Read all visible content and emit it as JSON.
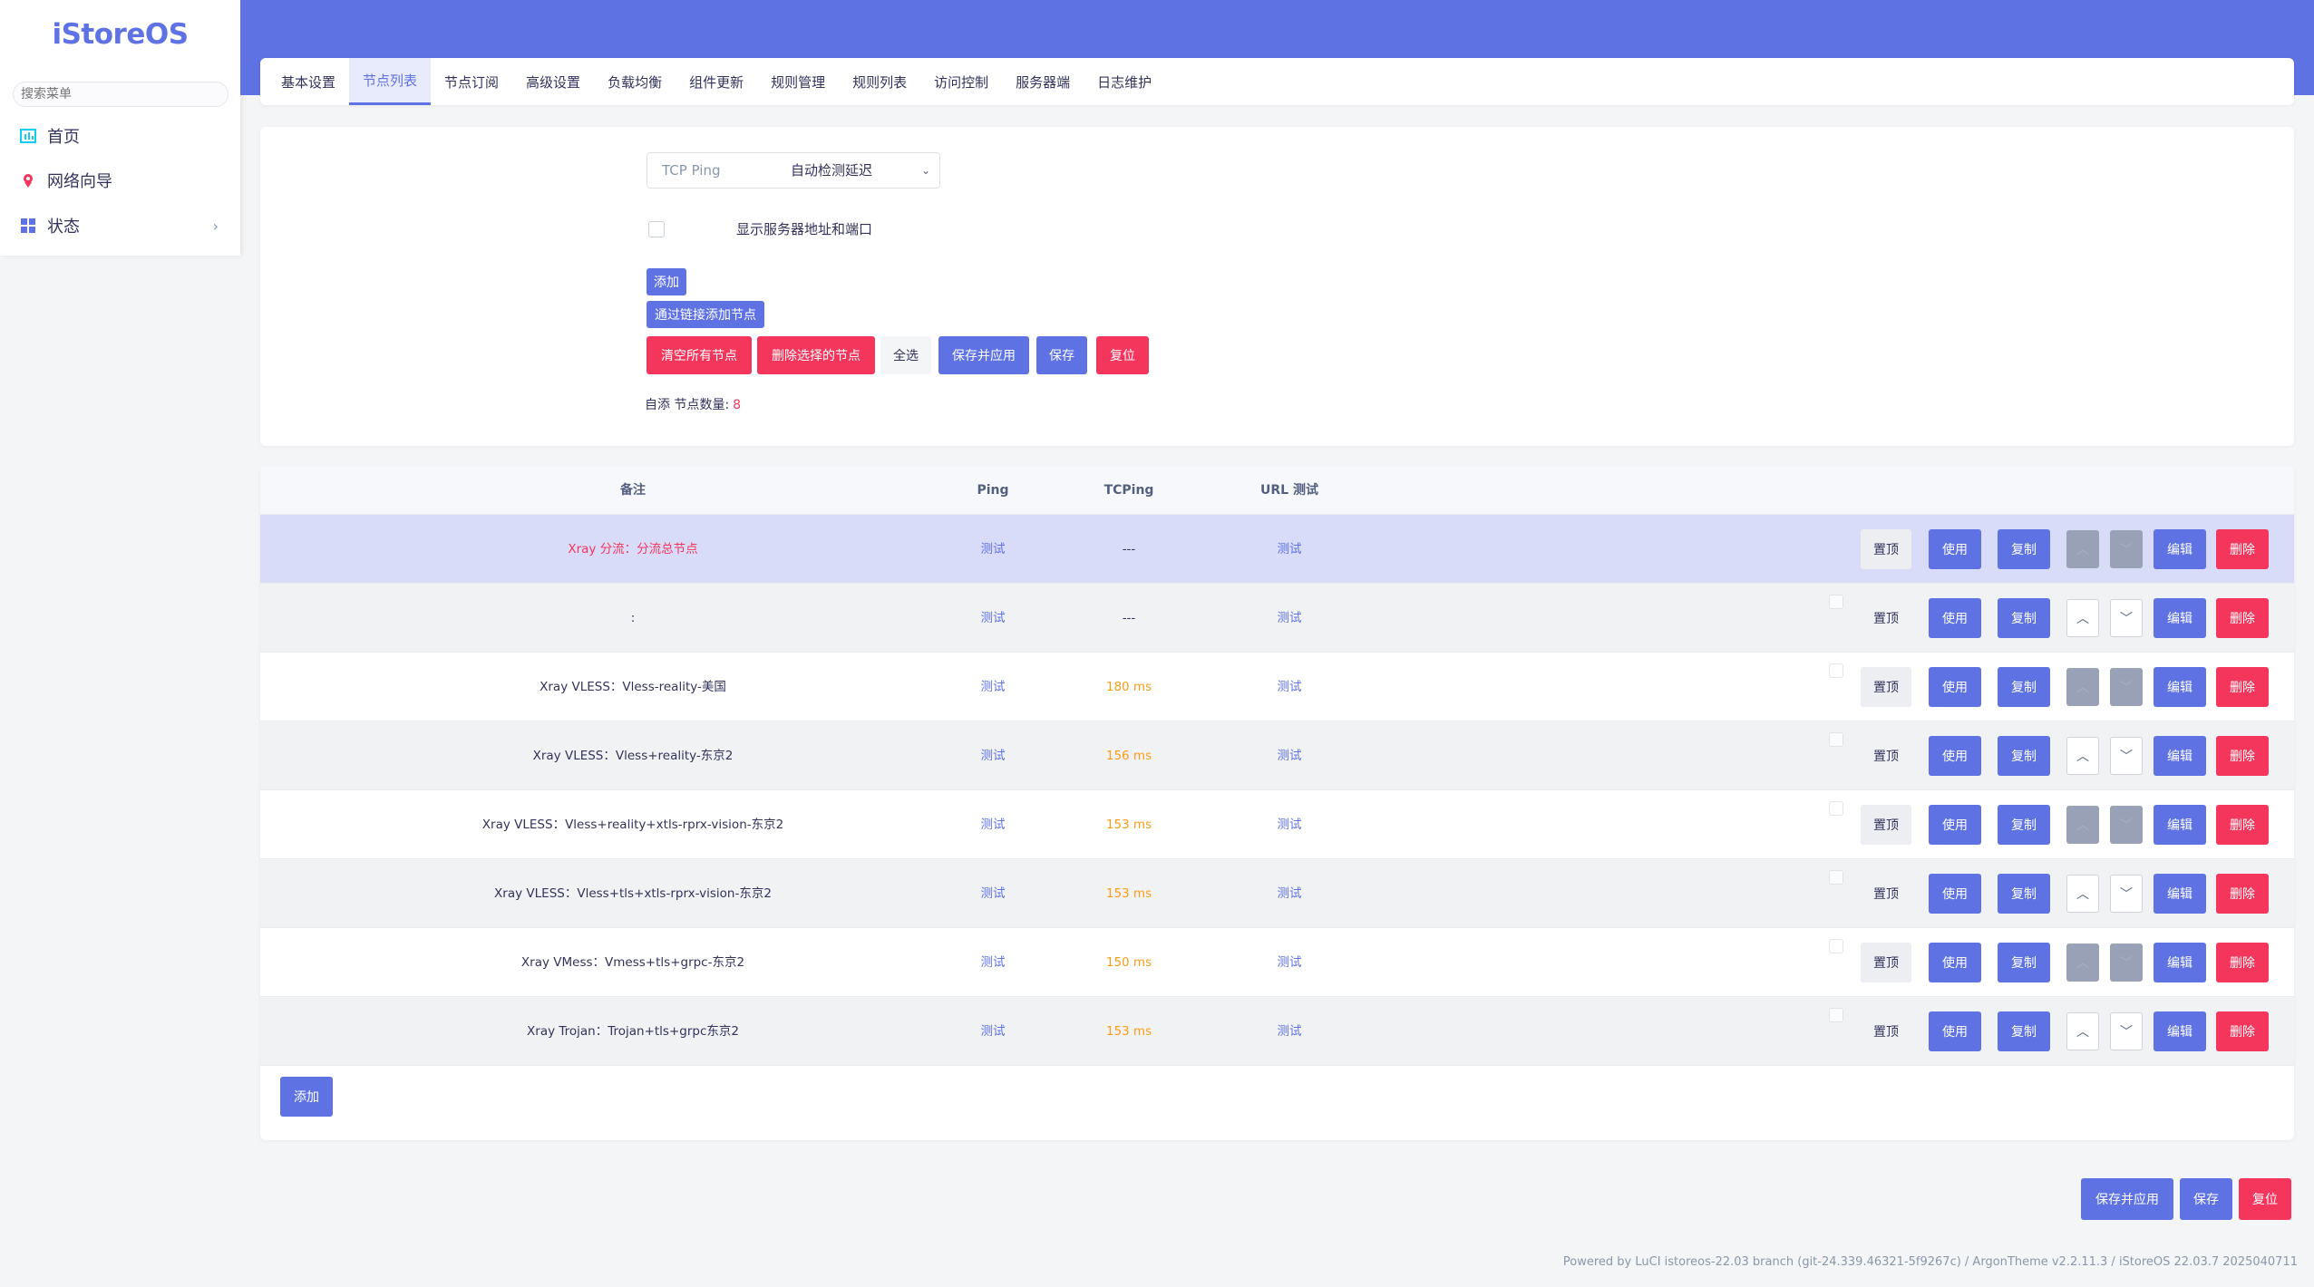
{
  "sidebar": {
    "brand": "iStoreOS",
    "search_placeholder": "搜索菜单",
    "items": [
      {
        "label": "首页",
        "icon": "dashboard-icon"
      },
      {
        "label": "网络向导",
        "icon": "wizard-icon"
      },
      {
        "label": "状态",
        "icon": "grid-icon"
      }
    ]
  },
  "tabs": [
    {
      "label": "基本设置",
      "active": false
    },
    {
      "label": "节点列表",
      "active": true
    },
    {
      "label": "节点订阅",
      "active": false
    },
    {
      "label": "高级设置",
      "active": false
    },
    {
      "label": "负载均衡",
      "active": false
    },
    {
      "label": "组件更新",
      "active": false
    },
    {
      "label": "规则管理",
      "active": false
    },
    {
      "label": "规则列表",
      "active": false
    },
    {
      "label": "访问控制",
      "active": false
    },
    {
      "label": "服务器端",
      "active": false
    },
    {
      "label": "日志维护",
      "active": false
    }
  ],
  "settings": {
    "auto_latency_label": "自动检测延迟",
    "auto_latency_value": "TCP Ping",
    "show_server_label": "显示服务器地址和端口",
    "show_server_checked": false,
    "btn_add": "添加",
    "btn_add_by_link": "通过链接添加节点",
    "btn_clear_all": "清空所有节点",
    "btn_delete_selected": "删除选择的节点",
    "btn_select_all": "全选",
    "btn_save_apply": "保存并应用",
    "btn_save": "保存",
    "btn_reset": "复位",
    "count_label": "自添 节点数量:",
    "count_value": "8"
  },
  "table": {
    "headers": {
      "remark": "备注",
      "ping": "Ping",
      "tcping": "TCPing",
      "url": "URL 测试"
    },
    "row_buttons": {
      "top": "置顶",
      "use": "使用",
      "copy": "复制",
      "edit": "编辑",
      "delete": "删除",
      "up": "︿",
      "down": "﹀"
    },
    "rows": [
      {
        "remark": "Xray 分流：分流总节点",
        "ping": "测试",
        "tcping": "---",
        "url": "测试",
        "highlight": true,
        "red": true
      },
      {
        "remark": ":",
        "ping": "测试",
        "tcping": "---",
        "url": "测试"
      },
      {
        "remark": "Xray VLESS：Vless-reality-美国",
        "ping": "测试",
        "tcping": "180 ms",
        "url": "测试"
      },
      {
        "remark": "Xray VLESS：Vless+reality-东京2",
        "ping": "测试",
        "tcping": "156 ms",
        "url": "测试"
      },
      {
        "remark": "Xray VLESS：Vless+reality+xtls-rprx-vision-东京2",
        "ping": "测试",
        "tcping": "153 ms",
        "url": "测试"
      },
      {
        "remark": "Xray VLESS：Vless+tls+xtls-rprx-vision-东京2",
        "ping": "测试",
        "tcping": "153 ms",
        "url": "测试"
      },
      {
        "remark": "Xray VMess：Vmess+tls+grpc-东京2",
        "ping": "测试",
        "tcping": "150 ms",
        "url": "测试"
      },
      {
        "remark": "Xray Trojan：Trojan+tls+grpc东京2",
        "ping": "测试",
        "tcping": "153 ms",
        "url": "测试"
      }
    ],
    "add_button": "添加"
  },
  "actions": {
    "save_apply": "保存并应用",
    "save": "保存",
    "reset": "复位"
  },
  "footer": {
    "text": "Powered by LuCI istoreos-22.03 branch (git-24.339.46321-5f9267c) / ArgonTheme v2.2.11.3 / iStoreOS 22.03.7 2025040711"
  },
  "colors": {
    "accent": "#5e72e4",
    "danger": "#f5365c",
    "warning": "#fb9c16"
  }
}
